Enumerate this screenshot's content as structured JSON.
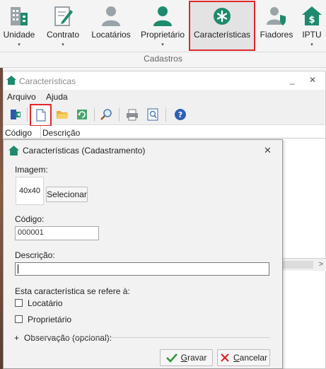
{
  "ribbon": {
    "buttons": [
      {
        "label": "Unidade",
        "icon": "building-icon",
        "caret": "▾"
      },
      {
        "label": "Contrato",
        "icon": "contract-pen-icon",
        "caret": "▾"
      },
      {
        "label": "Locatários",
        "icon": "person-icon",
        "caret": ""
      },
      {
        "label": "Proprietário",
        "icon": "person-green-icon",
        "caret": "▾"
      },
      {
        "label": "Características",
        "icon": "asterisk-circle-icon",
        "caret": ""
      },
      {
        "label": "Fiadores",
        "icon": "person-shield-icon",
        "caret": ""
      },
      {
        "label": "IPTU",
        "icon": "house-dollar-icon",
        "caret": "▾"
      }
    ],
    "group_label": "Cadastros",
    "colors": {
      "green": "#1e8a6e",
      "gray_icon": "#9aa3a8",
      "highlight": "#e0272c"
    }
  },
  "window": {
    "title": "Características",
    "minimize": "_",
    "close": "✕",
    "menu": [
      "Arquivo",
      "Ajuda"
    ],
    "toolbar_icons": [
      "exit-icon",
      "new-document-icon",
      "open-folder-icon",
      "refresh-icon",
      "search-icon",
      "print-icon",
      "print-preview-icon",
      "help-icon"
    ],
    "grid_columns": [
      "Código",
      "Descrição"
    ],
    "scroll_arrow": ">"
  },
  "dialog": {
    "title": "Características (Cadastramento)",
    "close": "✕",
    "image_label": "Imagem:",
    "image_placeholder": "40x40",
    "select_button": "Selecionar",
    "code_label": "Código:",
    "code_value": "000001",
    "description_label": "Descrição:",
    "description_value": "",
    "refers_label": "Esta característica se refere à:",
    "checkboxes": [
      {
        "label": "Locatário",
        "checked": false
      },
      {
        "label": "Proprietário",
        "checked": false
      }
    ],
    "observation_label": "Observação (opcional):",
    "observation_expander": "+",
    "save_label_first": "G",
    "save_label_rest": "ravar",
    "cancel_label_first": "C",
    "cancel_label_rest": "ancelar"
  }
}
